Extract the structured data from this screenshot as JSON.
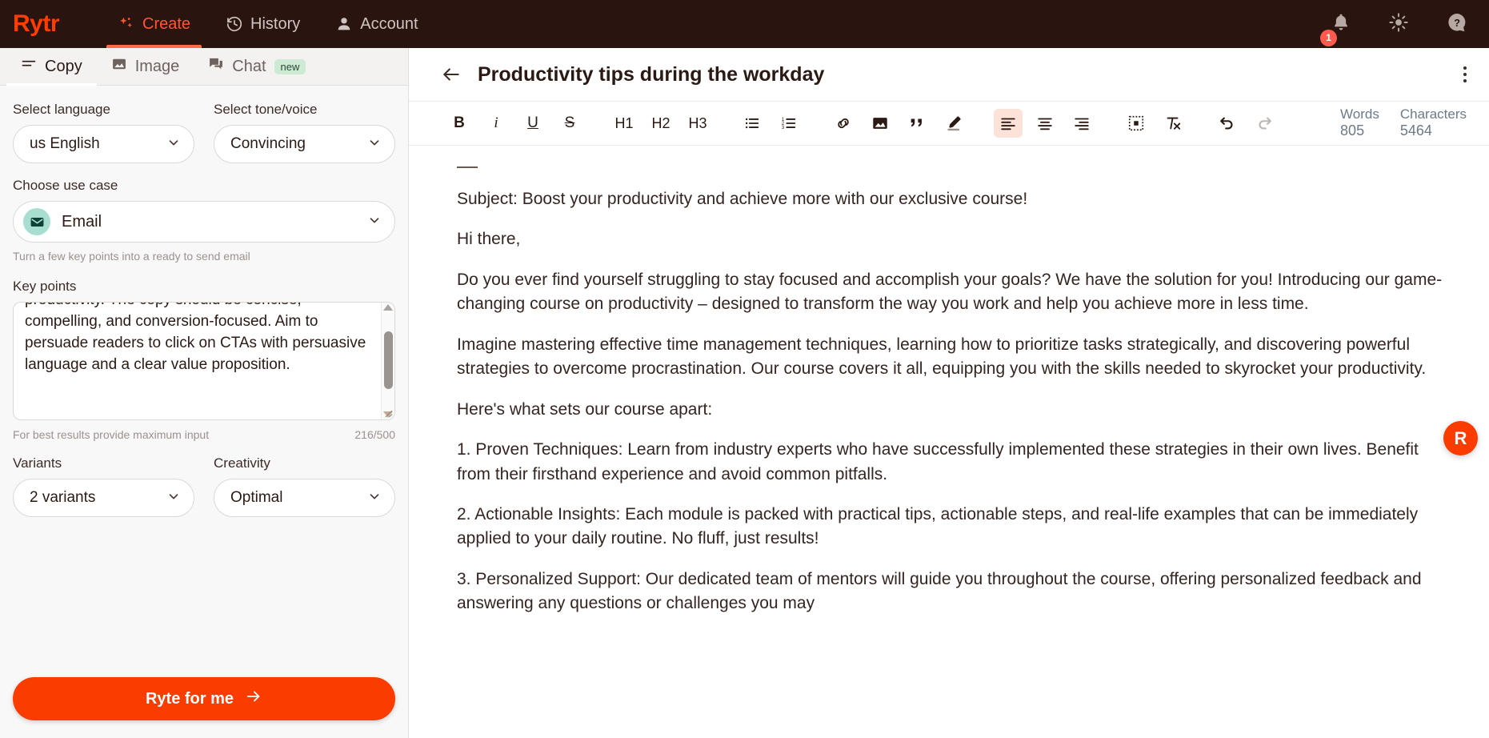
{
  "topnav": {
    "brand": "Rytr",
    "items": [
      {
        "label": "Create",
        "icon": "sparkle-icon",
        "active": true
      },
      {
        "label": "History",
        "icon": "history-clock-icon",
        "active": false
      },
      {
        "label": "Account",
        "icon": "person-icon",
        "active": false
      }
    ],
    "notifications_count": "1",
    "icons": [
      "bell-icon",
      "sun-theme-icon",
      "help-question-icon"
    ]
  },
  "left_panel": {
    "tabs": [
      {
        "label": "Copy",
        "icon": "menu-lines-icon",
        "active": true,
        "badge": ""
      },
      {
        "label": "Image",
        "icon": "image-icon",
        "active": false,
        "badge": ""
      },
      {
        "label": "Chat",
        "icon": "chat-bubble-icon",
        "active": false,
        "badge": "new"
      }
    ],
    "language": {
      "label": "Select language",
      "value": "us English"
    },
    "tone": {
      "label": "Select tone/voice",
      "value": "Convincing"
    },
    "use_case": {
      "label": "Choose use case",
      "value": "Email",
      "icon": "envelope-icon",
      "hint": "Turn a few key points into a ready to send email"
    },
    "key_points": {
      "label": "Key points",
      "value": "productivity. The copy should be concise, compelling, and conversion-focused. Aim to persuade readers to click on CTAs with persuasive language and a clear value proposition.",
      "footer_hint": "For best results provide maximum input",
      "counter": "216/500"
    },
    "variants": {
      "label": "Variants",
      "value": "2 variants"
    },
    "creativity": {
      "label": "Creativity",
      "value": "Optimal"
    },
    "submit": {
      "label": "Ryte for me",
      "icon": "arrow-right-icon"
    }
  },
  "document": {
    "title": "Productivity tips during the workday",
    "back_icon": "arrow-left-icon",
    "more_icon": "kebab-menu-icon",
    "toolbar": {
      "bold": "B",
      "italic": "i",
      "underline": "U",
      "strikethrough": "S",
      "h1": "H1",
      "h2": "H2",
      "h3": "H3",
      "bullet_list": "bullet-list-icon",
      "numbered_list": "numbered-list-icon",
      "link": "link-icon",
      "image": "image-icon",
      "quote": "quote-icon",
      "highlight": "pen-highlight-icon",
      "align_left": "align-left-icon",
      "align_center": "align-center-icon",
      "align_right": "align-right-icon",
      "border": "dashed-box-icon",
      "clear_format": "clear-formatting-icon",
      "undo": "undo-icon",
      "redo": "redo-icon"
    },
    "counters": [
      {
        "label": "Words",
        "value": "805"
      },
      {
        "label": "Characters",
        "value": "5464"
      }
    ],
    "content": [
      "Subject: Boost your productivity and achieve more with our exclusive course!",
      "Hi there,",
      "Do you ever find yourself struggling to stay focused and accomplish your goals? We have the solution for you! Introducing our game-changing course on productivity – designed to transform the way you work and help you achieve more in less time.",
      "Imagine mastering effective time management techniques, learning how to prioritize tasks strategically, and discovering powerful strategies to overcome procrastination. Our course covers it all, equipping you with the skills needed to skyrocket your productivity.",
      "Here's what sets our course apart:",
      "1. Proven Techniques: Learn from industry experts who have successfully implemented these strategies in their own lives. Benefit from their firsthand experience and avoid common pitfalls.",
      "2. Actionable Insights: Each module is packed with practical tips, actionable steps, and real-life examples that can be immediately applied to your daily routine. No fluff, just results!",
      "3. Personalized Support: Our dedicated team of mentors will guide you throughout the course, offering personalized feedback and answering any questions or challenges you may"
    ],
    "fab_label": "R"
  },
  "colors": {
    "brand_orange": "#fa3c00",
    "nav_bg": "#2a1410",
    "accent_active": "#ff5630",
    "toolbar_active_bg": "#fde2d8",
    "new_badge_bg": "#cdead4"
  }
}
